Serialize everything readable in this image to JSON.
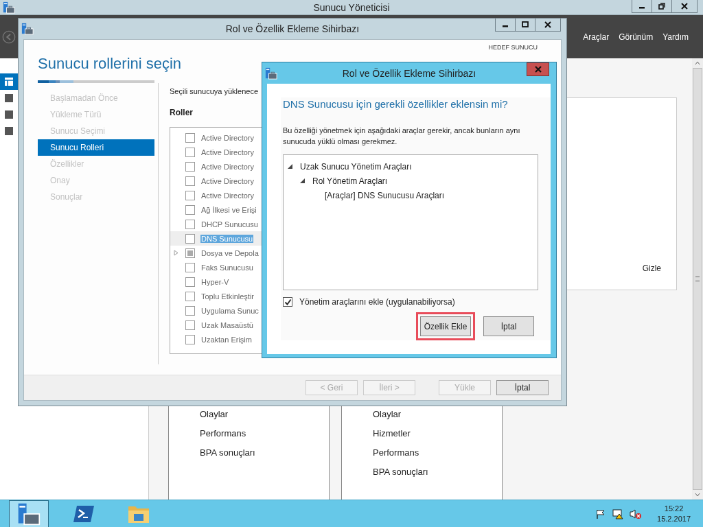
{
  "main_window": {
    "title": "Sunucu Yöneticisi",
    "menu": [
      "Araçlar",
      "Görünüm",
      "Yardım"
    ],
    "nav": [
      {
        "selected": true
      },
      {
        "selected": false
      },
      {
        "selected": false
      },
      {
        "selected": false
      }
    ],
    "hide_link": "Gizle",
    "tiles": [
      {
        "items": [
          "Olaylar",
          "Performans",
          "BPA sonuçları"
        ]
      },
      {
        "items": [
          "Olaylar",
          "Hizmetler",
          "Performans",
          "BPA sonuçları"
        ]
      }
    ]
  },
  "wizard": {
    "title": "Rol ve Özellik Ekleme Sihirbazı",
    "heading": "Sunucu rollerini seçin",
    "target_label": "HEDEF SUNUCU",
    "steps": [
      {
        "label": "Başlamadan Önce",
        "selected": false
      },
      {
        "label": "Yükleme Türü",
        "selected": false
      },
      {
        "label": "Sunucu Seçimi",
        "selected": false
      },
      {
        "label": "Sunucu Rolleri",
        "selected": true
      },
      {
        "label": "Özellikler",
        "selected": false
      },
      {
        "label": "Onay",
        "selected": false
      },
      {
        "label": "Sonuçlar",
        "selected": false
      }
    ],
    "description": "Seçili sunucuya yüklenece",
    "roles_label": "Roller",
    "roles": [
      {
        "label": "Active Directory",
        "checked": false,
        "partial": false,
        "expandable": false,
        "selected": false
      },
      {
        "label": "Active Directory",
        "checked": false,
        "partial": false,
        "expandable": false,
        "selected": false
      },
      {
        "label": "Active Directory",
        "checked": false,
        "partial": false,
        "expandable": false,
        "selected": false
      },
      {
        "label": "Active Directory",
        "checked": false,
        "partial": false,
        "expandable": false,
        "selected": false
      },
      {
        "label": "Active Directory",
        "checked": false,
        "partial": false,
        "expandable": false,
        "selected": false
      },
      {
        "label": "Ağ İlkesi ve Erişi",
        "checked": false,
        "partial": false,
        "expandable": false,
        "selected": false
      },
      {
        "label": "DHCP Sunucusu",
        "checked": false,
        "partial": false,
        "expandable": false,
        "selected": false
      },
      {
        "label": "DNS Sunucusu",
        "checked": false,
        "partial": false,
        "expandable": false,
        "selected": true
      },
      {
        "label": "Dosya ve Depola",
        "checked": false,
        "partial": true,
        "expandable": true,
        "selected": false
      },
      {
        "label": "Faks Sunucusu",
        "checked": false,
        "partial": false,
        "expandable": false,
        "selected": false
      },
      {
        "label": "Hyper-V",
        "checked": false,
        "partial": false,
        "expandable": false,
        "selected": false
      },
      {
        "label": "Toplu Etkinleştir",
        "checked": false,
        "partial": false,
        "expandable": false,
        "selected": false
      },
      {
        "label": "Uygulama Sunuc",
        "checked": false,
        "partial": false,
        "expandable": false,
        "selected": false
      },
      {
        "label": "Uzak Masaüstü",
        "checked": false,
        "partial": false,
        "expandable": false,
        "selected": false
      },
      {
        "label": "Uzaktan Erişim",
        "checked": false,
        "partial": false,
        "expandable": false,
        "selected": false
      }
    ],
    "buttons": [
      {
        "label": "< Geri",
        "disabled": true
      },
      {
        "label": "İleri >",
        "disabled": true
      },
      {
        "label": "Yükle",
        "disabled": true
      },
      {
        "label": "İptal",
        "disabled": false
      }
    ]
  },
  "dialog": {
    "title": "Rol ve Özellik Ekleme Sihirbazı",
    "question": "DNS Sunucusu için gerekli özellikler eklensin mi?",
    "description": "Bu özelliği yönetmek için aşağıdaki araçlar gerekir, ancak bunların aynı sunucuda yüklü olması gerekmez.",
    "tree": [
      {
        "label": "Uzak Sunucu Yönetim Araçları",
        "expanded": true,
        "children": [
          {
            "label": "Rol Yönetim Araçları",
            "expanded": true,
            "children": [
              {
                "label": "[Araçlar] DNS Sunucusu Araçları"
              }
            ]
          }
        ]
      }
    ],
    "include_tools": {
      "label": "Yönetim araçlarını ekle (uygulanabiliyorsa)",
      "checked": true
    },
    "buttons": [
      {
        "label": "Özellik Ekle",
        "highlighted": true
      },
      {
        "label": "İptal",
        "highlighted": false
      }
    ]
  },
  "taskbar": {
    "apps": [
      {
        "kind": "server",
        "selected": true
      },
      {
        "kind": "shell",
        "selected": false
      },
      {
        "kind": "folder",
        "selected": false
      }
    ],
    "time": "15:22",
    "date": "15.2.2017"
  }
}
